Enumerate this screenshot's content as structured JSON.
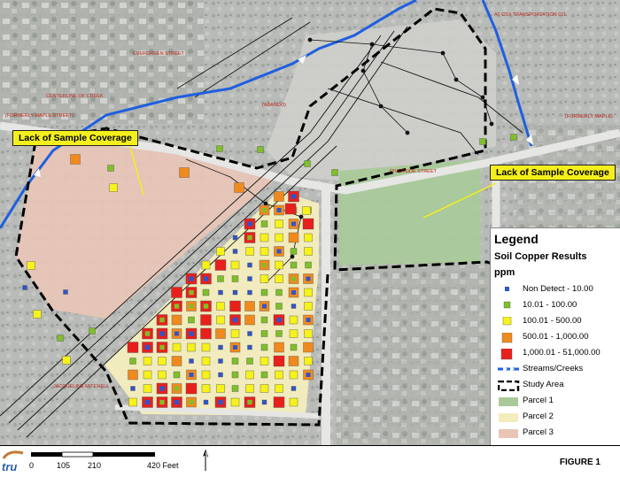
{
  "map": {
    "callouts": [
      {
        "text": "Lack of Sample Coverage"
      },
      {
        "text": "Lack of Sample Coverage"
      }
    ],
    "street_labels": [
      {
        "text": "CENTERLINE OF CREEK"
      },
      {
        "text": "(FORMERLY MAPLE STREET)"
      },
      {
        "text": "EVERGREEN STREET"
      },
      {
        "text": "(FORMERLY MAPLE)"
      },
      {
        "text": "RIVERSIDE STREET"
      },
      {
        "text": "JACQUELINE MITCHELL"
      },
      {
        "text": "(ABANDO)"
      },
      {
        "text": "AT CSX TRANSPORTATION CO."
      }
    ]
  },
  "legend": {
    "title": "Legend",
    "subtitle": "Soil Copper Results",
    "unit": "ppm",
    "items": [
      {
        "label": "Non Detect - 10.00",
        "color": "#2f55c8",
        "symbol": "square-small"
      },
      {
        "label": "10.01 - 100.00",
        "color": "#7fbf2a",
        "symbol": "square"
      },
      {
        "label": "100.01 - 500.00",
        "color": "#f6f21a",
        "symbol": "square"
      },
      {
        "label": "500.01 - 1,000.00",
        "color": "#f08a1e",
        "symbol": "square"
      },
      {
        "label": "1,000.01 - 51,000.00",
        "color": "#e8201c",
        "symbol": "square"
      },
      {
        "label": "Streams/Creeks",
        "color": "#1f5fe0",
        "symbol": "stream"
      },
      {
        "label": "Study Area",
        "color": "#000000",
        "symbol": "dashed-box"
      },
      {
        "label": "Parcel 1",
        "color": "#a9c99a",
        "symbol": "fill"
      },
      {
        "label": "Parcel 2",
        "color": "#f3edbe",
        "symbol": "fill"
      },
      {
        "label": "Parcel 3",
        "color": "#e8c5b6",
        "symbol": "fill"
      }
    ]
  },
  "scale_bar": {
    "labels": [
      "0",
      "105",
      "210",
      "420 Feet"
    ]
  },
  "footer": {
    "logo": "tru",
    "figure": "FIGURE 1"
  }
}
